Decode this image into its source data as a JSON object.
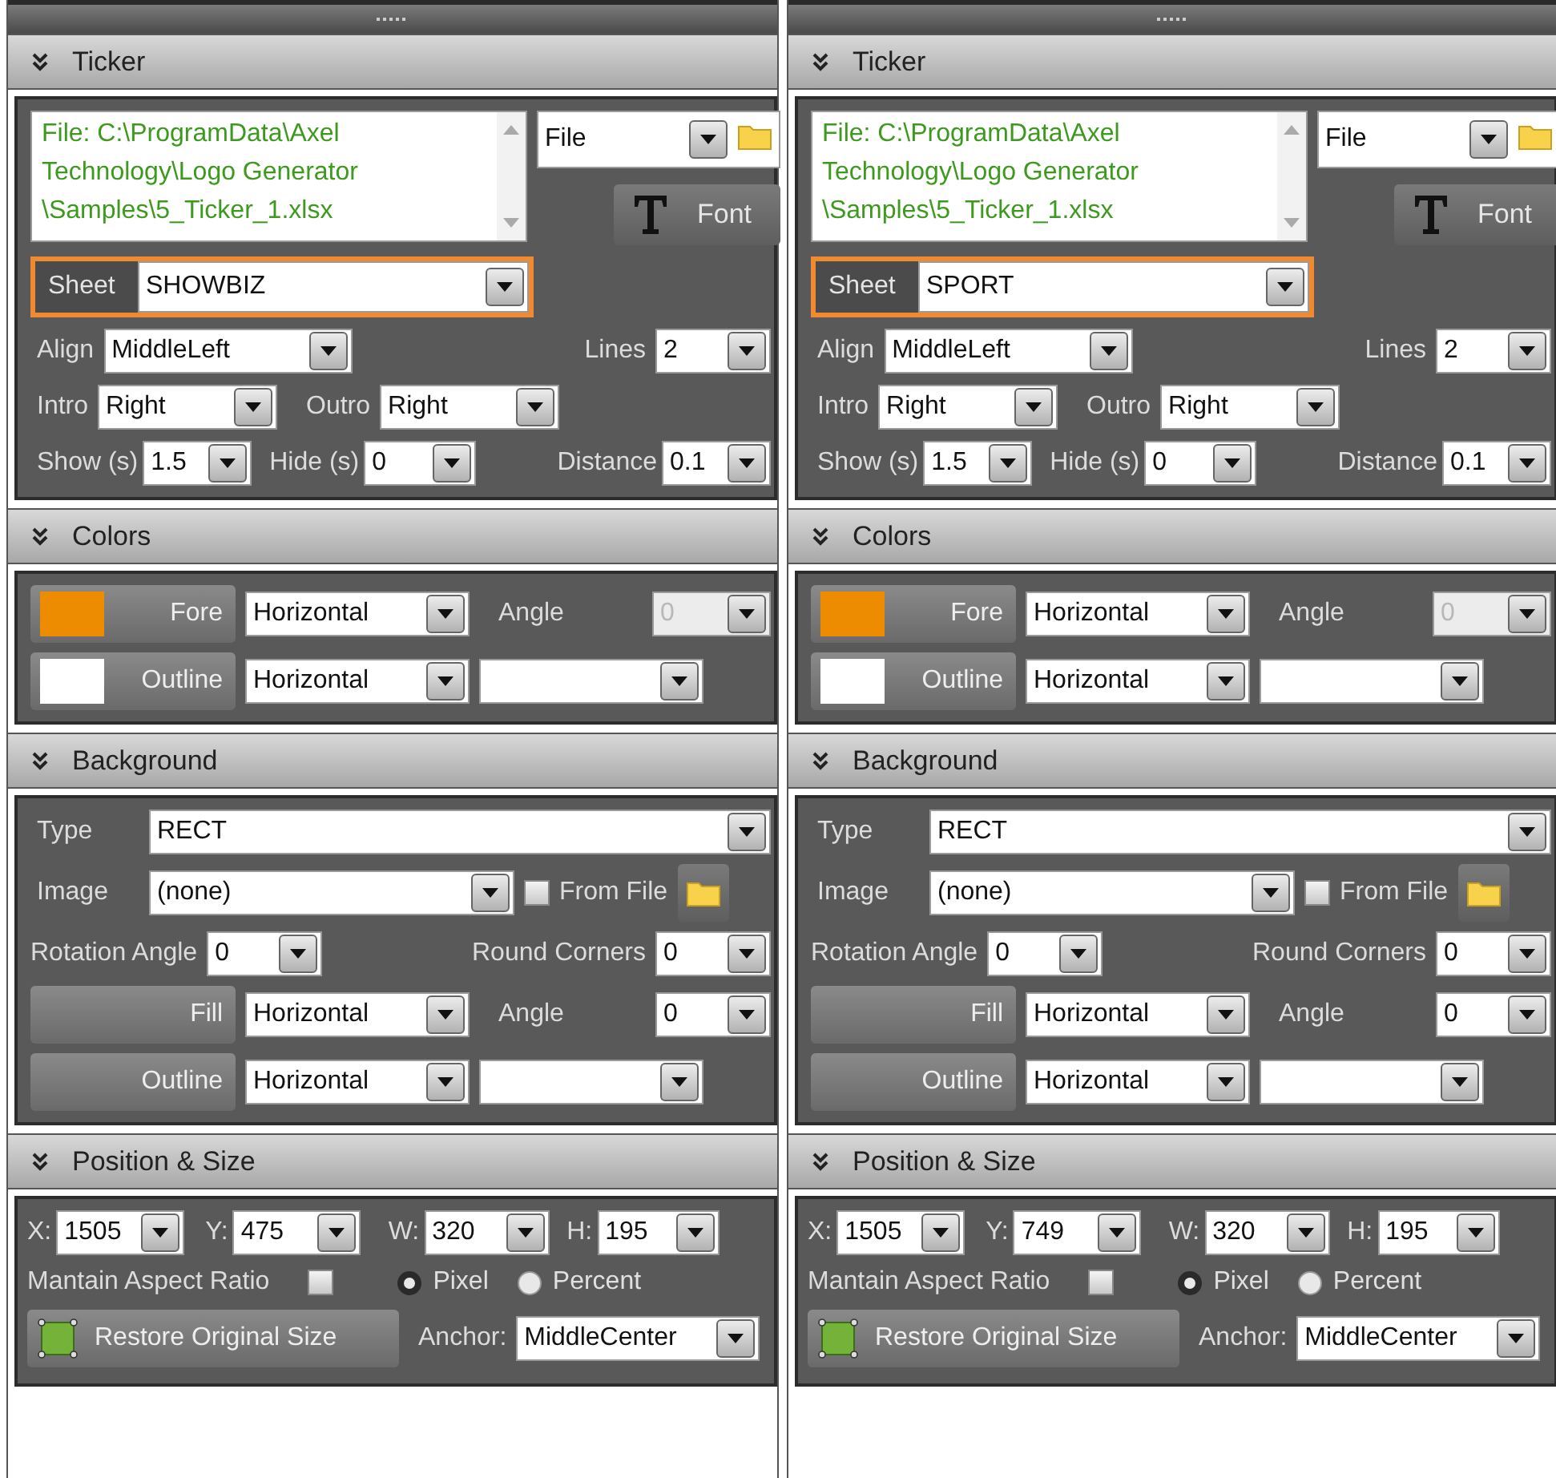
{
  "panels": [
    {
      "ticker": {
        "title": "Ticker",
        "expanded": true,
        "file_path_lines": [
          "File: C:\\ProgramData\\Axel",
          "Technology\\Logo Generator",
          "\\Samples\\5_Ticker_1.xlsx"
        ],
        "source": "File",
        "font_button": "Font",
        "sheet": {
          "label": "Sheet",
          "value": "SHOWBIZ",
          "highlighted": true
        },
        "align": {
          "label": "Align",
          "value": "MiddleLeft"
        },
        "lines": {
          "label": "Lines",
          "value": "2"
        },
        "intro": {
          "label": "Intro",
          "value": "Right"
        },
        "outro": {
          "label": "Outro",
          "value": "Right"
        },
        "show": {
          "label": "Show (s)",
          "value": "1.5"
        },
        "hide": {
          "label": "Hide (s)",
          "value": "0"
        },
        "distance": {
          "label": "Distance",
          "value": "0.1"
        }
      },
      "colors": {
        "title": "Colors",
        "expanded": true,
        "rows": [
          {
            "label": "Fore",
            "color": "#ee8c00",
            "mode": "Horizontal",
            "extra_label": "Angle",
            "extra_value": "0",
            "extra_disabled": true
          },
          {
            "label": "Outline",
            "color": "#ffffff",
            "mode": "Horizontal",
            "extra_disabled": false
          }
        ]
      },
      "background": {
        "title": "Background",
        "expanded": true,
        "type": {
          "label": "Type",
          "value": "RECT"
        },
        "image": {
          "label": "Image",
          "value": "(none)"
        },
        "from_file": {
          "label": "From File",
          "checked": false
        },
        "rotation": {
          "label": "Rotation Angle",
          "value": "0"
        },
        "round_corners": {
          "label": "Round Corners",
          "value": "0"
        },
        "fill": {
          "label": "Fill",
          "mode": "Horizontal",
          "angle_label": "Angle",
          "angle": "0"
        },
        "outline": {
          "label": "Outline",
          "mode": "Horizontal"
        }
      },
      "position": {
        "title": "Position & Size",
        "expanded": true,
        "x": {
          "label": "X:",
          "value": "1505"
        },
        "y": {
          "label": "Y:",
          "value": "475"
        },
        "w": {
          "label": "W:",
          "value": "320"
        },
        "h": {
          "label": "H:",
          "value": "195"
        },
        "maintain": {
          "label": "Mantain Aspect Ratio",
          "checked": false
        },
        "units": [
          {
            "label": "Pixel",
            "selected": true
          },
          {
            "label": "Percent",
            "selected": false
          }
        ],
        "restore_button": "Restore Original Size",
        "anchor": {
          "label": "Anchor:",
          "value": "MiddleCenter"
        }
      }
    },
    {
      "ticker": {
        "title": "Ticker",
        "expanded": true,
        "file_path_lines": [
          "File: C:\\ProgramData\\Axel",
          "Technology\\Logo Generator",
          "\\Samples\\5_Ticker_1.xlsx"
        ],
        "source": "File",
        "font_button": "Font",
        "sheet": {
          "label": "Sheet",
          "value": "SPORT",
          "highlighted": true
        },
        "align": {
          "label": "Align",
          "value": "MiddleLeft"
        },
        "lines": {
          "label": "Lines",
          "value": "2"
        },
        "intro": {
          "label": "Intro",
          "value": "Right"
        },
        "outro": {
          "label": "Outro",
          "value": "Right"
        },
        "show": {
          "label": "Show (s)",
          "value": "1.5"
        },
        "hide": {
          "label": "Hide (s)",
          "value": "0"
        },
        "distance": {
          "label": "Distance",
          "value": "0.1"
        }
      },
      "colors": {
        "title": "Colors",
        "expanded": true,
        "rows": [
          {
            "label": "Fore",
            "color": "#ee8c00",
            "mode": "Horizontal",
            "extra_label": "Angle",
            "extra_value": "0",
            "extra_disabled": true
          },
          {
            "label": "Outline",
            "color": "#ffffff",
            "mode": "Horizontal",
            "extra_disabled": false
          }
        ]
      },
      "background": {
        "title": "Background",
        "expanded": true,
        "type": {
          "label": "Type",
          "value": "RECT"
        },
        "image": {
          "label": "Image",
          "value": "(none)"
        },
        "from_file": {
          "label": "From File",
          "checked": false
        },
        "rotation": {
          "label": "Rotation Angle",
          "value": "0"
        },
        "round_corners": {
          "label": "Round Corners",
          "value": "0"
        },
        "fill": {
          "label": "Fill",
          "mode": "Horizontal",
          "angle_label": "Angle",
          "angle": "0"
        },
        "outline": {
          "label": "Outline",
          "mode": "Horizontal"
        }
      },
      "position": {
        "title": "Position & Size",
        "expanded": true,
        "x": {
          "label": "X:",
          "value": "1505"
        },
        "y": {
          "label": "Y:",
          "value": "749"
        },
        "w": {
          "label": "W:",
          "value": "320"
        },
        "h": {
          "label": "H:",
          "value": "195"
        },
        "maintain": {
          "label": "Mantain Aspect Ratio",
          "checked": false
        },
        "units": [
          {
            "label": "Pixel",
            "selected": true
          },
          {
            "label": "Percent",
            "selected": false
          }
        ],
        "restore_button": "Restore Original Size",
        "anchor": {
          "label": "Anchor:",
          "value": "MiddleCenter"
        }
      }
    }
  ]
}
